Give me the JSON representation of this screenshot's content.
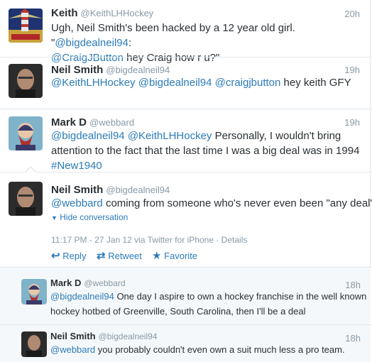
{
  "tweets": [
    {
      "name": "Keith",
      "handle": "@KeithLHHockey",
      "time": "20h",
      "text_plain1": "Ugh, Neil Smith's been hacked by a 12 year old girl. \"",
      "link1": "@bigdealneil94",
      "text_plain2": ":",
      "link2": "@CraigJButton",
      "text_plain3": " hey Craig how r u?\""
    },
    {
      "name": "Neil Smith",
      "handle": "@bigdealneil94",
      "time": "19h",
      "link1": "@KeithLHHockey",
      "link2": "@bigdealneil94",
      "link3": "@craigjbutton",
      "text_plain": " hey keith GFY"
    },
    {
      "name": "Mark D",
      "handle": "@webbard",
      "time": "19h",
      "link1": "@bigdealneil94",
      "link2": "@KeithLHHockey",
      "text_line1_rest": " Personally, I wouldn't bring",
      "text_line2": "attention to the fact that the last time I was a big deal was in 1994",
      "hashtag": "#New1940"
    },
    {
      "name": "Neil Smith",
      "handle": "@bigdealneil94",
      "link1": "@webbard",
      "text_plain": " coming from someone who's never even been \"any deal\".",
      "hide_conversation": "Hide conversation",
      "meta": "11:17 PM - 27 Jan 12 via Twitter for iPhone · Details",
      "reply": "Reply",
      "retweet": "Retweet",
      "favorite": "Favorite"
    },
    {
      "name": "Mark D",
      "handle": "@webbard",
      "time": "18h",
      "link1": "@bigdealneil94",
      "text_line1_rest": " One day I aspire to own a hockey franchise in the well known",
      "text_line2": "hockey hotbed of Greenville, South Carolina, then I'll be a deal"
    },
    {
      "name": "Neil Smith",
      "handle": "@bigdealneil94",
      "time": "18h",
      "link1": "@webbard",
      "text_plain": " you probably couldn't even own a suit much less a pro team."
    }
  ],
  "colors": {
    "link": "#2b7bb9",
    "muted": "#8899a6",
    "text": "#292f33"
  }
}
